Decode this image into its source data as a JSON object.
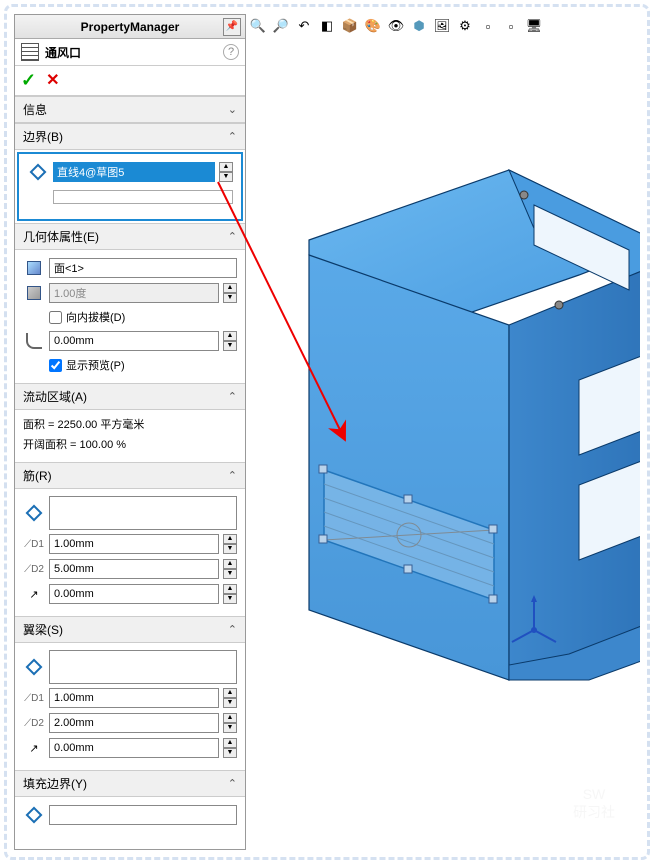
{
  "panel": {
    "title": "PropertyManager",
    "feature_name": "通风口",
    "confirm": {
      "ok": "✓",
      "cancel": "✕"
    }
  },
  "sections": {
    "info": {
      "title": "信息"
    },
    "boundary": {
      "title": "边界(B)",
      "selection": "直线4@草图5"
    },
    "geom": {
      "title": "几何体属性(E)",
      "face": "面<1>",
      "angle": "1.00度",
      "draft_in": "向内拔模(D)",
      "radius": "0.00mm",
      "preview": "显示预览(P)"
    },
    "flow": {
      "title": "流动区域(A)",
      "area_lbl": "面积 = 2250.00 平方毫米",
      "open_lbl": "开阔面积 = 100.00 %"
    },
    "rib": {
      "title": "筋(R)",
      "d1": "1.00mm",
      "d2": "5.00mm",
      "off": "0.00mm"
    },
    "spar": {
      "title": "翼梁(S)",
      "d1": "1.00mm",
      "d2": "2.00mm",
      "off": "0.00mm"
    },
    "fill": {
      "title": "填充边界(Y)"
    }
  },
  "watermark": {
    "l1": "SW",
    "l2": "研习社"
  }
}
